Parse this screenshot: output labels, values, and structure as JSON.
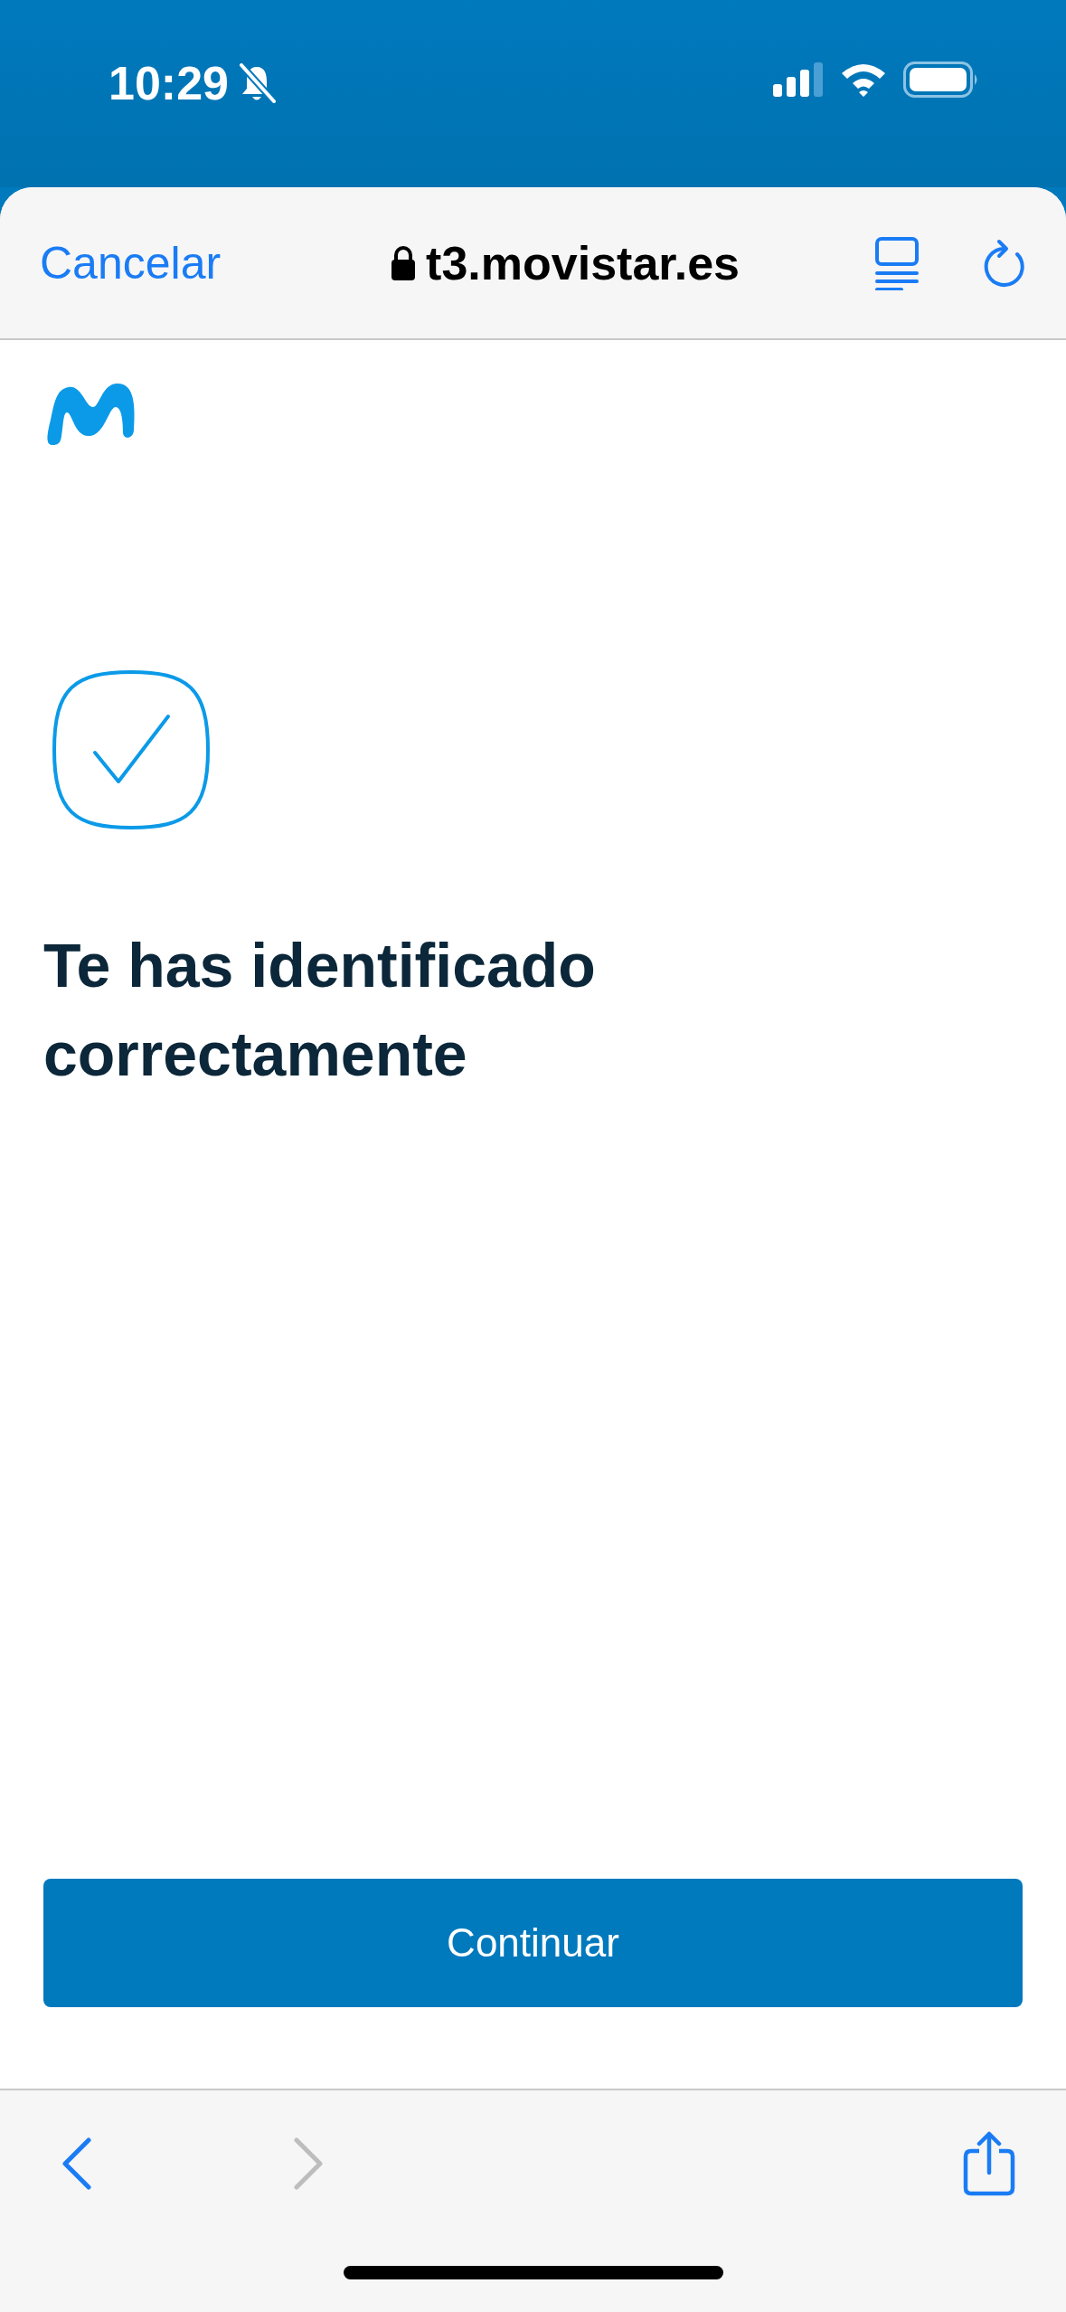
{
  "status_bar": {
    "time": "10:29",
    "silent": true
  },
  "browser_header": {
    "cancel": "Cancelar",
    "url": "t3.movistar.es",
    "secure": true
  },
  "page": {
    "heading": "Te has identificado correctamente",
    "button": "Continuar"
  },
  "toolbar": {
    "buttons": [
      {
        "kind": "back",
        "disabled": false
      },
      {
        "kind": "forward",
        "disabled": true
      },
      {
        "kind": "share",
        "disabled": false
      }
    ]
  }
}
